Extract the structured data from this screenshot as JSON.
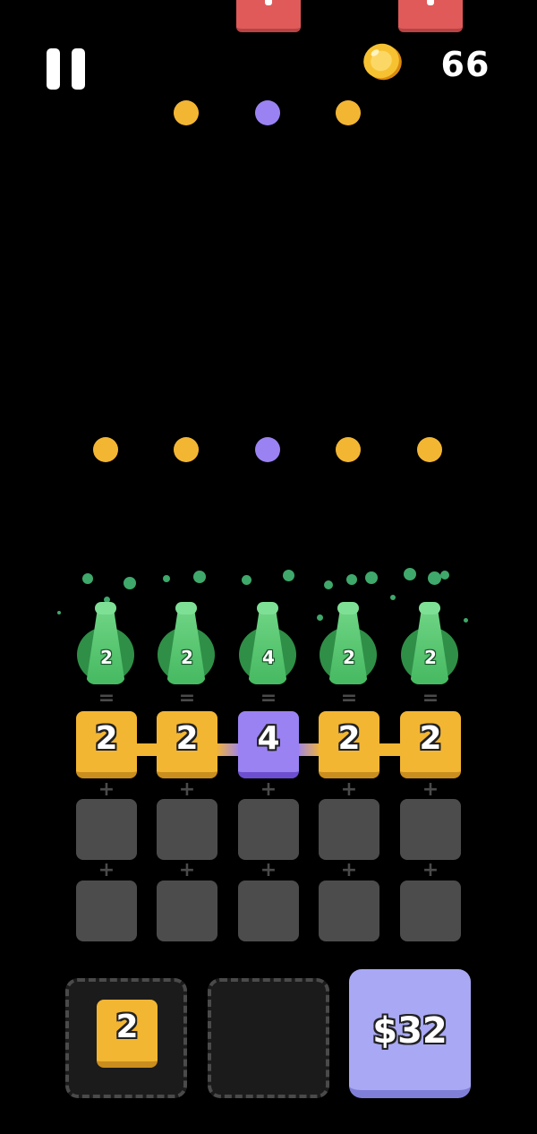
{
  "hud": {
    "coins": "66",
    "icons": {
      "pause": "pause-icon",
      "coin": "coin-icon"
    }
  },
  "colors": {
    "yellow": "#f3b633",
    "purple": "#9b82f2",
    "enemy": "#e05a5a",
    "green": "#46b961",
    "slot": "#4c4c4c",
    "buy": "#a8a8f4"
  },
  "bullets_top": [
    "yellow",
    "purple",
    "yellow"
  ],
  "bullets_mid": [
    "yellow",
    "yellow",
    "purple",
    "yellow",
    "yellow"
  ],
  "shooters": [
    {
      "value": "2",
      "color": "green"
    },
    {
      "value": "2",
      "color": "green"
    },
    {
      "value": "4",
      "color": "green"
    },
    {
      "value": "2",
      "color": "green"
    },
    {
      "value": "2",
      "color": "green"
    }
  ],
  "merge_row": [
    {
      "value": "2",
      "color": "yellow"
    },
    {
      "value": "2",
      "color": "yellow"
    },
    {
      "value": "4",
      "color": "purple"
    },
    {
      "value": "2",
      "color": "yellow"
    },
    {
      "value": "2",
      "color": "yellow"
    }
  ],
  "operators": {
    "equals": "=",
    "plus": "+"
  },
  "tray": {
    "held_tile_value": "2",
    "buy_price": "$32"
  }
}
